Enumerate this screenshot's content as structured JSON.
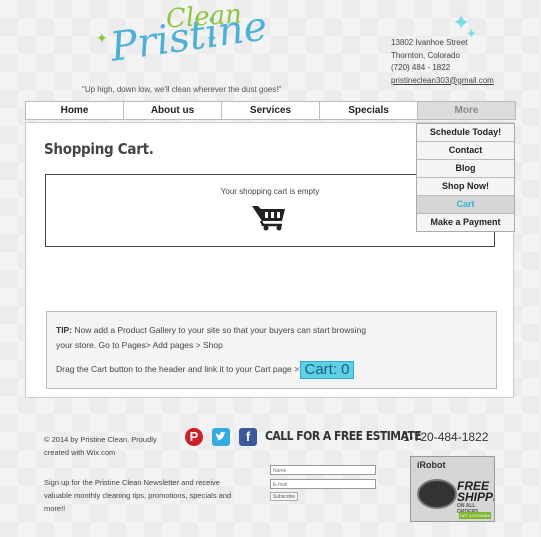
{
  "brand": {
    "logo_word1": "Pristine",
    "logo_word2": "Clean",
    "tagline": "\"Up high, down low, we'll clean wherever the dust goes!\""
  },
  "contact": {
    "street": "13802 Ivanhoe Street",
    "city": "Thornton, Colorado",
    "phone": "(720) 484 - 1822",
    "email": "pristineclean303@gmail.com"
  },
  "nav": {
    "items": [
      "Home",
      "About us",
      "Services",
      "Specials",
      "More"
    ]
  },
  "dropdown": {
    "items": [
      "Schedule Today!",
      "Contact",
      "Blog",
      "Shop Now!",
      "Cart",
      "Make a Payment"
    ],
    "selected": "Cart"
  },
  "page": {
    "title": "Shopping Cart.",
    "cart_empty": "Your shopping cart is empty"
  },
  "tip": {
    "label": "TIP:",
    "text": "Now add a Product Gallery to your site so that your buyers can start browsing your store. Go to Pages> Add pages > Shop",
    "drag": "Drag the Cart button to the header and link it to your Cart page >>",
    "cart_button": "Cart: 0"
  },
  "footer": {
    "copyright": "© 2014 by Pristine Clean. Proudly created with Wix.com",
    "newsletter": "Sign up for the Pristine Clean Newsletter and receive valuable monthly cleaning tips, promotions, specials and more!!",
    "estimate": "CALL FOR A FREE ESTIMATE",
    "phone": "1-720-484-1822",
    "name_placeholder": "Name",
    "email_placeholder": "E-mail",
    "subscribe": "Subscribe"
  },
  "ad": {
    "brand": "iRobot",
    "free": "FREE",
    "shipping": "SHIPPING",
    "sub": "ON ALL ORDERS",
    "button": "GET A ROOMBA ▸"
  },
  "colors": {
    "accent": "#36b3d6",
    "cart_button": "#5dcfe6",
    "logo_blue": "#4db0d6",
    "logo_green": "#8cc63f"
  },
  "icons": [
    "cart-icon",
    "pinterest-icon",
    "twitter-icon",
    "facebook-icon",
    "sparkle-icon"
  ]
}
